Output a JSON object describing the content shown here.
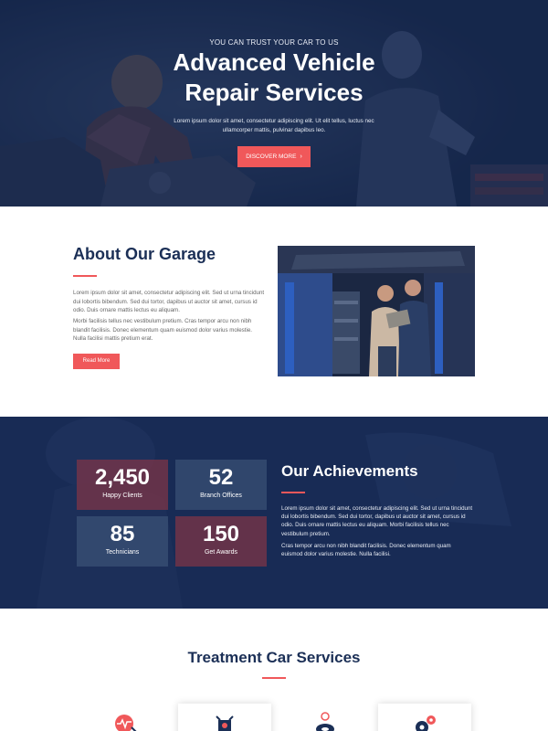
{
  "hero": {
    "eyebrow": "YOU CAN TRUST YOUR CAR TO US",
    "title_line1": "Advanced Vehicle",
    "title_line2": "Repair Services",
    "description": "Lorem ipsum dolor sit amet, consectetur adipiscing elit. Ut elit tellus, luctus nec ullamcorper mattis, pulvinar dapibus leo.",
    "button_label": "DISCOVER MORE",
    "button_icon": "chevron-right-icon"
  },
  "about": {
    "title": "About Our Garage",
    "paragraph1": "Lorem ipsum dolor sit amet, consectetur adipiscing elit. Sed ut urna tincidunt dui lobortis bibendum. Sed dui tortor, dapibus ut auctor sit amet, cursus id odio. Duis ornare mattis lectus eu aliquam.",
    "paragraph2": "Morbi facilisis tellus nec vestibulum pretium. Cras tempor arcu non nibh blandit facilisis. Donec elementum quam euismod dolor varius molestie. Nulla facilisi mattis pretium erat.",
    "button_label": "Read More"
  },
  "achievements": {
    "title": "Our Achievements",
    "stats": [
      {
        "value": "2,450",
        "label": "Happy Clients"
      },
      {
        "value": "52",
        "label": "Branch Offices"
      },
      {
        "value": "85",
        "label": "Technicians"
      },
      {
        "value": "150",
        "label": "Get Awards"
      }
    ],
    "paragraph1": "Lorem ipsum dolor sit amet, consectetur adipiscing elit. Sed ut urna tincidunt dui lobortis bibendum. Sed dui tortor, dapibus ut auctor sit amet, cursus id odio. Duis ornare mattis lectus eu aliquam. Morbi facilisis tellus nec vestibulum pretium.",
    "paragraph2": "Cras tempor arcu non nibh blandit facilisis. Donec elementum quam euismod dolor varius molestie. Nulla facilisi."
  },
  "services": {
    "title": "Treatment Car Services",
    "icons": [
      "diagnostics-icon",
      "engine-icon",
      "tire-icon",
      "gear-service-icon"
    ]
  },
  "colors": {
    "accent": "#f0585a",
    "navy": "#1b2f56",
    "hero_overlay": "#1d3258"
  }
}
